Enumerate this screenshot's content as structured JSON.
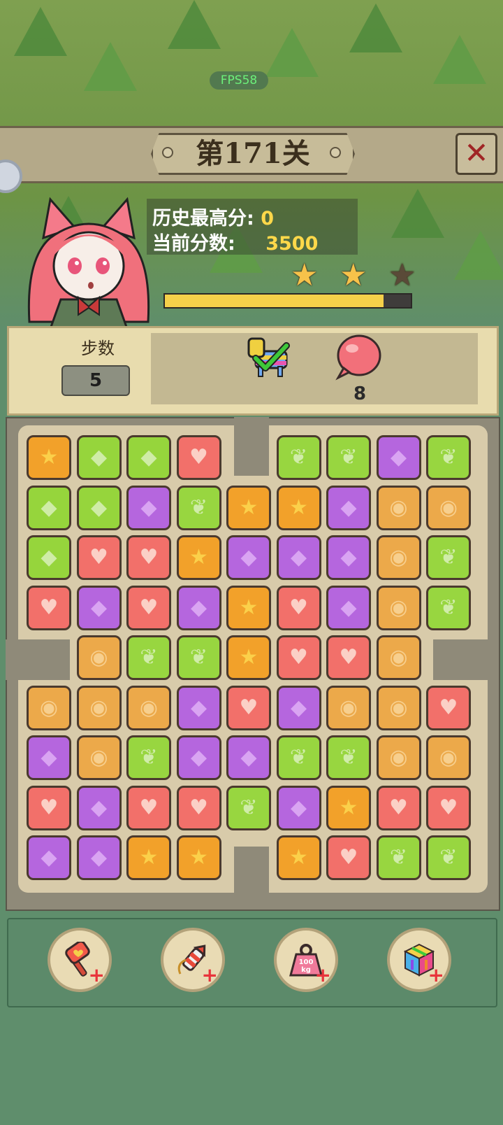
{
  "status": {
    "fps": "FPS58"
  },
  "header": {
    "title": "第171关",
    "close_label": "✕"
  },
  "score": {
    "best_label": "历史最高分:",
    "best_value": "0",
    "current_label": "当前分数:",
    "current_value": "3500",
    "stars_earned": 2,
    "stars_total": 3,
    "progress_fraction": 0.89
  },
  "goals": {
    "steps_label": "步数",
    "steps_value": "5",
    "items": [
      {
        "icon": "pinata-horse-icon",
        "done": true
      },
      {
        "icon": "balloon-icon",
        "count": "8"
      }
    ]
  },
  "board": {
    "rows": [
      [
        "star",
        "green",
        "green",
        "heart",
        null,
        "lime",
        "lime",
        "purple",
        "lime"
      ],
      [
        "green",
        "green",
        "purple",
        "lime",
        "star",
        "star",
        "purple",
        "gold",
        "gold"
      ],
      [
        "green",
        "heart",
        "heart",
        "star",
        "purple",
        "purple",
        "purple",
        "gold",
        "lime"
      ],
      [
        "heart",
        "purple",
        "heart",
        "purple",
        "star",
        "heart",
        "purple",
        "gold",
        "lime"
      ],
      [
        null,
        "gold",
        "lime",
        "lime",
        "star",
        "heart",
        "heart",
        "gold",
        null
      ],
      [
        "gold",
        "gold",
        "gold",
        "purple",
        "heart",
        "purple",
        "gold",
        "gold",
        "heart"
      ],
      [
        "purple",
        "gold",
        "lime",
        "purple",
        "purple",
        "lime",
        "lime",
        "gold",
        "gold"
      ],
      [
        "heart",
        "purple",
        "heart",
        "heart",
        "lime",
        "purple",
        "star",
        "heart",
        "heart"
      ],
      [
        "purple",
        "purple",
        "star",
        "star",
        null,
        "star",
        "heart",
        "lime",
        "lime"
      ]
    ]
  },
  "boosters": [
    {
      "icon": "hammer-icon"
    },
    {
      "icon": "rocket-icon"
    },
    {
      "icon": "weight-icon",
      "label": "100 kg"
    },
    {
      "icon": "rainbow-cube-icon"
    }
  ],
  "colors": {
    "star": "#f2a12a",
    "green": "#96d53c",
    "heart": "#f2706a",
    "purple": "#b566de",
    "gold": "#eca94a",
    "lime": "#98d640"
  }
}
